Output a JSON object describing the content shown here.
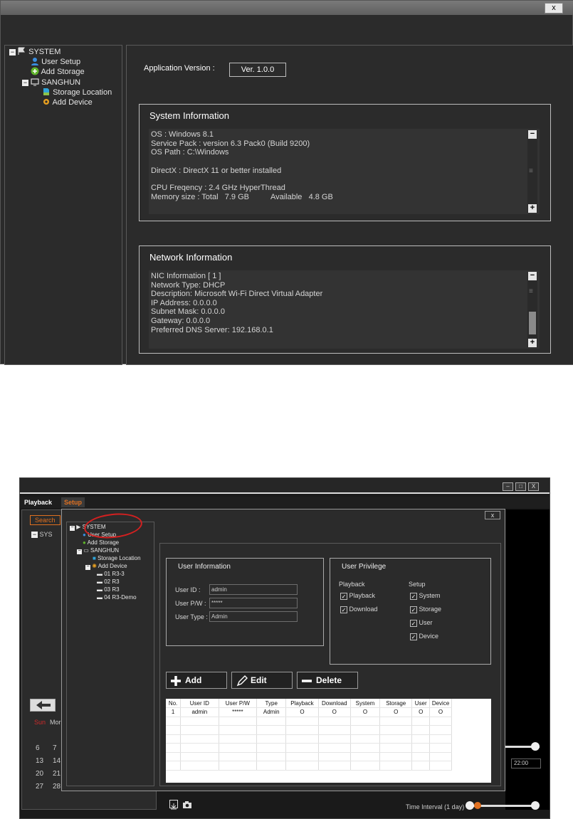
{
  "top": {
    "close_label": "x",
    "tree": {
      "system": "SYSTEM",
      "user_setup": "User Setup",
      "add_storage": "Add Storage",
      "site": "SANGHUN",
      "storage_location": "Storage Location",
      "add_device": "Add Device"
    },
    "app_version_label": "Application Version :",
    "app_version_value": "Ver. 1.0.0",
    "system_info": {
      "title": "System Information",
      "os": "OS : Windows 8.1",
      "service_pack": "Service Pack : version 6.3 Pack0 (Build 9200)",
      "os_path": "OS Path : C:\\Windows",
      "directx": "DirectX : DirectX 11 or better installed",
      "cpu": "CPU Freqency : 2.4 GHz HyperThread",
      "mem_label": "Memory size : Total",
      "mem_total": "7.9 GB",
      "mem_avail_label": "Available",
      "mem_avail": "4.8 GB"
    },
    "network_info": {
      "title": "Network Information",
      "nic": "NIC Information [ 1 ]",
      "type": "Network Type: DHCP",
      "desc": "Description: Microsoft Wi-Fi Direct Virtual Adapter",
      "ip": "IP Address: 0.0.0.0",
      "subnet": "Subnet Mask: 0.0.0.0",
      "gateway": "Gateway: 0.0.0.0",
      "dns": "Preferred DNS Server: 192.168.0.1"
    },
    "scroll_minus": "−",
    "scroll_plus": "+",
    "scroll_grip": "≡"
  },
  "bottom": {
    "tabs": {
      "playback": "Playback",
      "setup": "Setup"
    },
    "search_label": "Search",
    "bg_tree_fragment": "SYS",
    "win_min": "–",
    "win_max": "□",
    "win_close": "X",
    "dialog_close": "x",
    "tree": {
      "system": "SYSTEM",
      "user_setup": "User Setup",
      "add_storage": "Add Storage",
      "site": "SANGHUN",
      "storage_location": "Storage Location",
      "add_device": "Add Device",
      "devices": [
        "01 R3-3",
        "02 R3",
        "03 R3",
        "04 R3-Demo"
      ]
    },
    "user_info": {
      "title": "User Information",
      "id_label": "User ID :",
      "id_value": "admin",
      "pw_label": "User P/W :",
      "pw_value": "*****",
      "type_label": "User Type :",
      "type_value": "Admin"
    },
    "privilege": {
      "title": "User Privilege",
      "playback_header": "Playback",
      "setup_header": "Setup",
      "playback_items": [
        "Playback",
        "Download"
      ],
      "setup_items": [
        "System",
        "Storage",
        "User",
        "Device"
      ],
      "check": "✓"
    },
    "buttons": {
      "add": "Add",
      "edit": "Edit",
      "delete": "Delete"
    },
    "table": {
      "headers": [
        "No.",
        "User ID",
        "User P/W",
        "Type",
        "Playback",
        "Download",
        "System",
        "Storage",
        "User",
        "Device"
      ],
      "rows": [
        [
          "1",
          "admin",
          "*****",
          "Admin",
          "O",
          "O",
          "O",
          "O",
          "O",
          "O"
        ]
      ]
    },
    "calendar": {
      "sun": "Sun",
      "mon": "Mor",
      "rows": [
        [
          "6",
          "7"
        ],
        [
          "13",
          "14"
        ],
        [
          "20",
          "21"
        ],
        [
          "27",
          "28"
        ]
      ]
    },
    "time_label": "22:00",
    "time_interval": "Time Interval (1 day)",
    "colors": {
      "accent": "#e07020",
      "red_text": "#cc2a2a",
      "highlight_circle": "#d42020"
    }
  }
}
